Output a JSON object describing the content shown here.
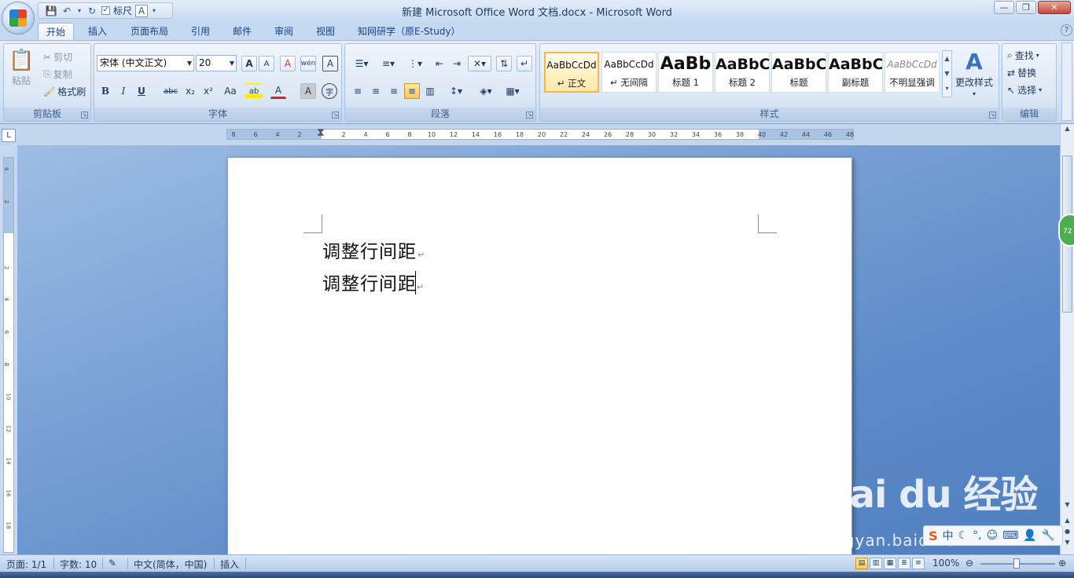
{
  "window": {
    "title": "新建 Microsoft Office Word 文档.docx - Microsoft Word"
  },
  "qat": {
    "ruler_label": "标尺",
    "ruler_checked": true
  },
  "tabs": [
    "开始",
    "插入",
    "页面布局",
    "引用",
    "邮件",
    "审阅",
    "视图",
    "知网研学（原E-Study）"
  ],
  "active_tab": "开始",
  "clipboard": {
    "paste": "粘贴",
    "cut": "剪切",
    "copy": "复制",
    "format_painter": "格式刷",
    "group": "剪贴板"
  },
  "font": {
    "name": "宋体 (中文正文)",
    "size": "20",
    "group": "字体",
    "bold": "B",
    "italic": "I",
    "underline": "U",
    "strike": "abc",
    "sub": "x₂",
    "sup": "x²",
    "case": "Aa",
    "highlight": "ab",
    "color": "A",
    "shade": "A",
    "enclose": "字",
    "grow": "A",
    "shrink": "A",
    "clear": "A",
    "phonetic": "wén",
    "border": "A"
  },
  "paragraph": {
    "group": "段落"
  },
  "styles": {
    "group": "样式",
    "items": [
      {
        "preview": "AaBbCcDd",
        "name": "↵ 正文"
      },
      {
        "preview": "AaBbCcDd",
        "name": "↵ 无间隔"
      },
      {
        "preview": "AaBb",
        "name": "标题 1"
      },
      {
        "preview": "AaBbC",
        "name": "标题 2"
      },
      {
        "preview": "AaBbC",
        "name": "标题"
      },
      {
        "preview": "AaBbC",
        "name": "副标题"
      },
      {
        "preview": "AaBbCcDd",
        "name": "不明显强调"
      }
    ],
    "change_styles": "更改样式"
  },
  "editing": {
    "group": "编辑",
    "find": "查找",
    "replace": "替换",
    "select": "选择"
  },
  "ruler": {
    "left_ticks": [
      "8",
      "6",
      "4",
      "2"
    ],
    "right_ticks": [
      "2",
      "4",
      "6",
      "8",
      "10",
      "12",
      "14",
      "16",
      "18",
      "20",
      "22",
      "24",
      "26",
      "28",
      "30",
      "32",
      "34",
      "36",
      "38",
      "40",
      "42",
      "44",
      "46",
      "48"
    ],
    "vertical_ticks": [
      "4",
      "2",
      "2",
      "4",
      "6",
      "8",
      "10",
      "12",
      "14",
      "16",
      "18"
    ]
  },
  "document": {
    "lines": [
      "调整行间距",
      "调整行间距"
    ]
  },
  "side_badge": "72",
  "ime": {
    "text": "中"
  },
  "watermark": {
    "brand": "Bai du 经验",
    "url": "jingyan.baidu.com"
  },
  "status": {
    "page": "页面: 1/1",
    "words": "字数: 10",
    "language": "中文(简体，中国)",
    "mode": "插入",
    "zoom": "100%"
  }
}
